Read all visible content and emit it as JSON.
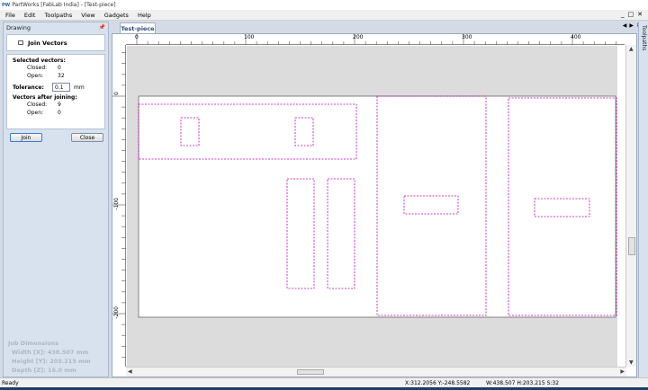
{
  "window": {
    "icon_text": "PW",
    "title": "PartWorks [FabLab India] - [Test-piece]",
    "controls": [
      "_",
      "□",
      "✕"
    ]
  },
  "menu": [
    "File",
    "Edit",
    "Toolpaths",
    "View",
    "Gadgets",
    "Help"
  ],
  "panel": {
    "header": "Drawing",
    "tool_title": "Join Vectors",
    "selected_heading": "Selected vectors:",
    "selected_closed_label": "Closed:",
    "selected_closed_value": "0",
    "selected_open_label": "Open:",
    "selected_open_value": "32",
    "tolerance_label": "Tolerance:",
    "tolerance_value": "0.1",
    "tolerance_unit": "mm",
    "after_heading": "Vectors after joining:",
    "after_closed_label": "Closed:",
    "after_closed_value": "9",
    "after_open_label": "Open:",
    "after_open_value": "0",
    "join_label": "Join",
    "close_label": "Close"
  },
  "job": {
    "heading": "Job Dimensions",
    "width": "Width  [X]: 438.507 mm",
    "height": "Height [Y]: 203.215 mm",
    "depth": "Depth  [Z]: 16.0 mm"
  },
  "doc_tab": "Test-piece",
  "ruler": {
    "top_labels": [
      "0",
      "100",
      "200",
      "300",
      "400"
    ],
    "left_labels": [
      "0",
      "-100",
      "-200"
    ]
  },
  "toolpaths_tab": "Toolpaths",
  "status": {
    "ready": "Ready",
    "coords": "X:312.2056 Y:-248.5582",
    "dims": "W:438.507   H:203.215   S:32"
  },
  "colors": {
    "vector": "#c000c0",
    "job_area": "#ffffff",
    "background": "#dcdcdc"
  }
}
